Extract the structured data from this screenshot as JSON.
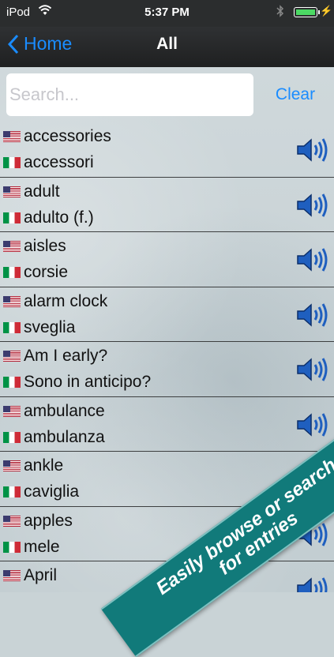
{
  "status": {
    "carrier": "iPod",
    "time": "5:37 PM"
  },
  "nav": {
    "back_label": "Home",
    "title": "All"
  },
  "search": {
    "placeholder": "Search...",
    "clear_label": "Clear"
  },
  "entries": [
    {
      "en": "accessories",
      "it": "accessori"
    },
    {
      "en": "adult",
      "it": "adulto (f.)"
    },
    {
      "en": "aisles",
      "it": "corsie"
    },
    {
      "en": "alarm clock",
      "it": "sveglia"
    },
    {
      "en": "Am I early?",
      "it": "Sono in anticipo?"
    },
    {
      "en": "ambulance",
      "it": "ambulanza"
    },
    {
      "en": "ankle",
      "it": "caviglia"
    },
    {
      "en": "apples",
      "it": "mele"
    },
    {
      "en": "April",
      "it": ""
    }
  ],
  "banner": {
    "line1": "Easily browse or search",
    "line2": "for entries"
  },
  "colors": {
    "accent": "#1a8cff",
    "banner": "#117a7a",
    "navbar": "#2b2d2e"
  }
}
